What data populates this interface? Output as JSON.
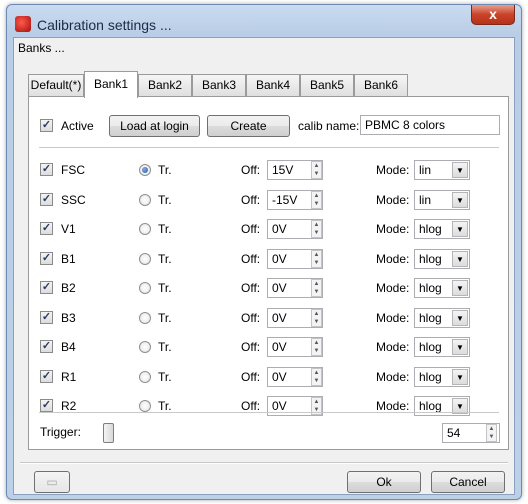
{
  "window": {
    "title": "Calibration settings ...",
    "close_symbol": "x",
    "accent": "#c8432a"
  },
  "banks_label": "Banks ...",
  "tabs": [
    {
      "label": "Default(*)",
      "active": false
    },
    {
      "label": "Bank1",
      "active": true
    },
    {
      "label": "Bank2",
      "active": false
    },
    {
      "label": "Bank3",
      "active": false
    },
    {
      "label": "Bank4",
      "active": false
    },
    {
      "label": "Bank5",
      "active": false
    },
    {
      "label": "Bank6",
      "active": false
    }
  ],
  "header": {
    "active_label": "Active",
    "active_checked": true,
    "load_button": "Load at login",
    "create_button": "Create",
    "calib_name_label": "calib name:",
    "calib_name_value": "PBMC 8 colors"
  },
  "labels": {
    "tr": "Tr.",
    "off": "Off:",
    "mode": "Mode:"
  },
  "channels": [
    {
      "name": "FSC",
      "checked": true,
      "tr": true,
      "off": "15V",
      "mode": "lin"
    },
    {
      "name": "SSC",
      "checked": true,
      "tr": false,
      "off": "-15V",
      "mode": "lin"
    },
    {
      "name": "V1",
      "checked": true,
      "tr": false,
      "off": "0V",
      "mode": "hlog"
    },
    {
      "name": "B1",
      "checked": true,
      "tr": false,
      "off": "0V",
      "mode": "hlog"
    },
    {
      "name": "B2",
      "checked": true,
      "tr": false,
      "off": "0V",
      "mode": "hlog"
    },
    {
      "name": "B3",
      "checked": true,
      "tr": false,
      "off": "0V",
      "mode": "hlog"
    },
    {
      "name": "B4",
      "checked": true,
      "tr": false,
      "off": "0V",
      "mode": "hlog"
    },
    {
      "name": "R1",
      "checked": true,
      "tr": false,
      "off": "0V",
      "mode": "hlog"
    },
    {
      "name": "R2",
      "checked": true,
      "tr": false,
      "off": "0V",
      "mode": "hlog"
    }
  ],
  "trigger": {
    "label": "Trigger:",
    "value": "54"
  },
  "footer": {
    "ok": "Ok",
    "cancel": "Cancel"
  }
}
